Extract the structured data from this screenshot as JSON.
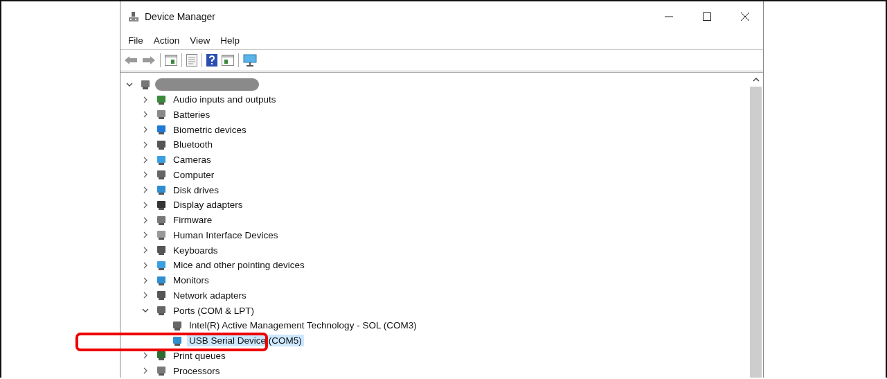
{
  "window": {
    "title": "Device Manager"
  },
  "menu": [
    "File",
    "Action",
    "View",
    "Help"
  ],
  "tree": {
    "root": {
      "redacted": true,
      "expanded": true,
      "children": [
        {
          "label": "Audio inputs and outputs",
          "expanded": false,
          "selected": false
        },
        {
          "label": "Batteries",
          "expanded": false,
          "selected": false
        },
        {
          "label": "Biometric devices",
          "expanded": false,
          "selected": false
        },
        {
          "label": "Bluetooth",
          "expanded": false,
          "selected": false
        },
        {
          "label": "Cameras",
          "expanded": false,
          "selected": false
        },
        {
          "label": "Computer",
          "expanded": false,
          "selected": false
        },
        {
          "label": "Disk drives",
          "expanded": false,
          "selected": false
        },
        {
          "label": "Display adapters",
          "expanded": false,
          "selected": false
        },
        {
          "label": "Firmware",
          "expanded": false,
          "selected": false
        },
        {
          "label": "Human Interface Devices",
          "expanded": false,
          "selected": false
        },
        {
          "label": "Keyboards",
          "expanded": false,
          "selected": false
        },
        {
          "label": "Mice and other pointing devices",
          "expanded": false,
          "selected": false
        },
        {
          "label": "Monitors",
          "expanded": false,
          "selected": false
        },
        {
          "label": "Network adapters",
          "expanded": false,
          "selected": false
        },
        {
          "label": "Ports (COM & LPT)",
          "expanded": true,
          "selected": false,
          "children": [
            {
              "label": "Intel(R) Active Management Technology - SOL (COM3)",
              "selected": false
            },
            {
              "label": "USB Serial Device (COM5)",
              "selected": true
            }
          ]
        },
        {
          "label": "Print queues",
          "expanded": false,
          "selected": false
        },
        {
          "label": "Processors",
          "expanded": false,
          "selected": false
        }
      ]
    }
  }
}
